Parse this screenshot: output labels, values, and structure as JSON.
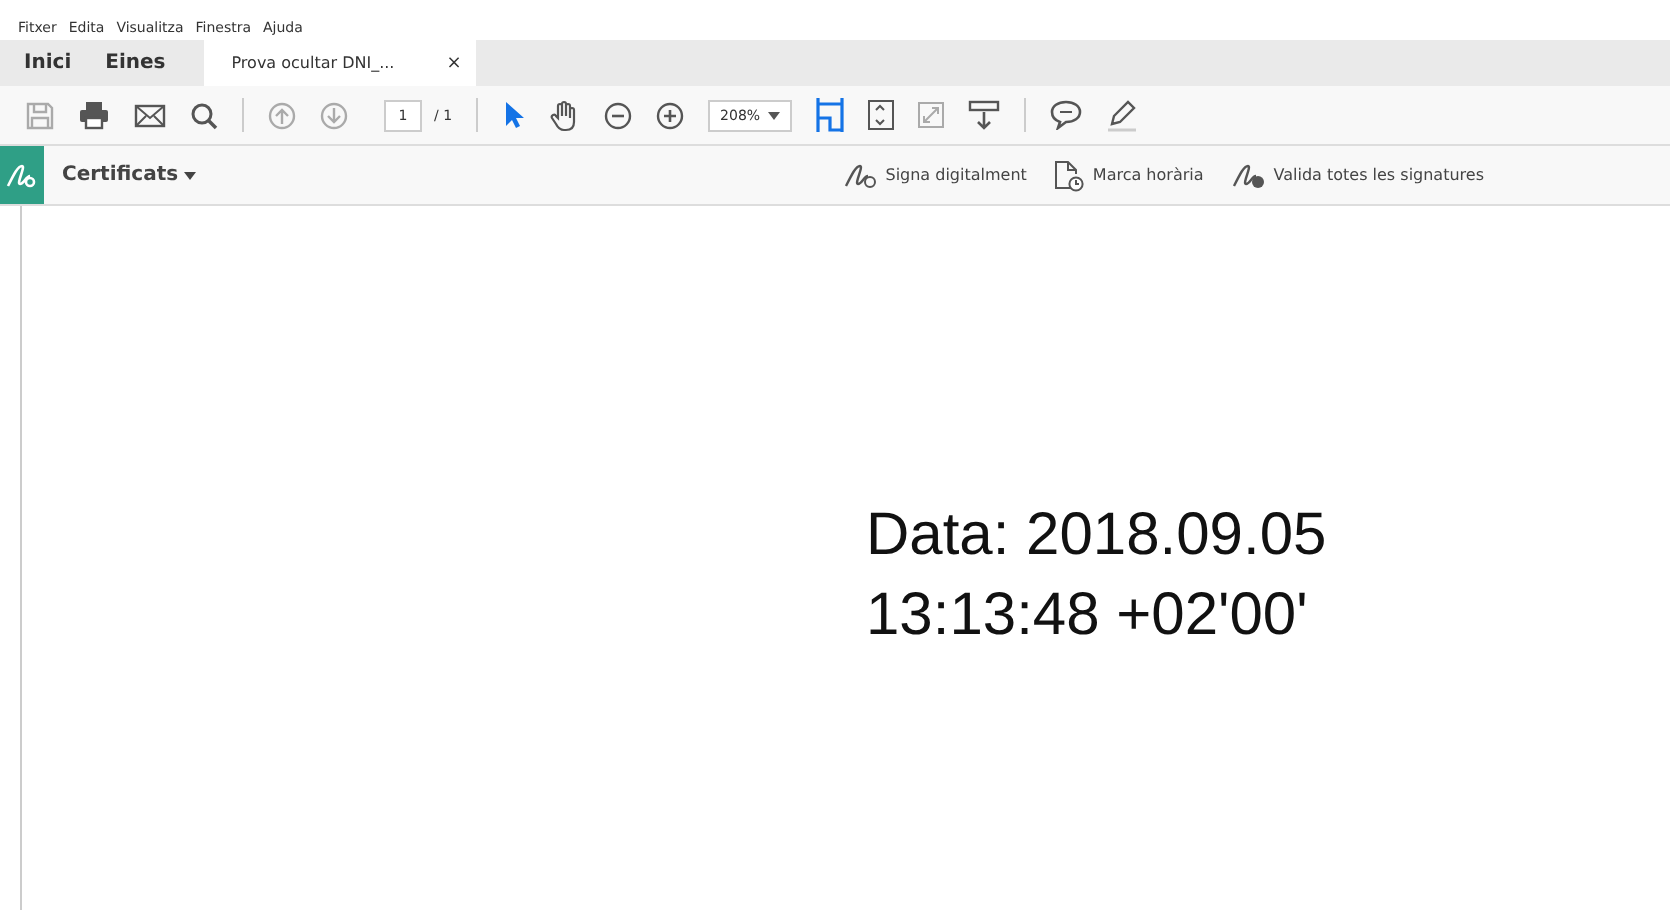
{
  "menu": [
    "Fitxer",
    "Edita",
    "Visualitza",
    "Finestra",
    "Ajuda"
  ],
  "tabs": [
    {
      "label": "Inici",
      "selected": false,
      "kind": "nav"
    },
    {
      "label": "Eines",
      "selected": false,
      "kind": "nav"
    },
    {
      "label": "Prova ocultar DNI_...",
      "selected": true,
      "kind": "document",
      "close": "×"
    }
  ],
  "toolbar": {
    "tools": [
      {
        "kind": "select",
        "selected": true
      },
      {
        "kind": "hand",
        "selected": false
      }
    ],
    "page": {
      "value": "1",
      "total": "/ 1"
    },
    "zoom": {
      "value": "208%"
    }
  },
  "certificates_bar": {
    "label": "Certificats",
    "actions": [
      {
        "kind": "sign",
        "label": "Signa digitalment"
      },
      {
        "kind": "timestamp",
        "label": "Marca horària"
      },
      {
        "kind": "validate",
        "label": "Valida totes les signatures"
      }
    ]
  },
  "document": {
    "lines": [
      "Data: 2018.09.05",
      "13:13:48 +02'00'"
    ]
  }
}
